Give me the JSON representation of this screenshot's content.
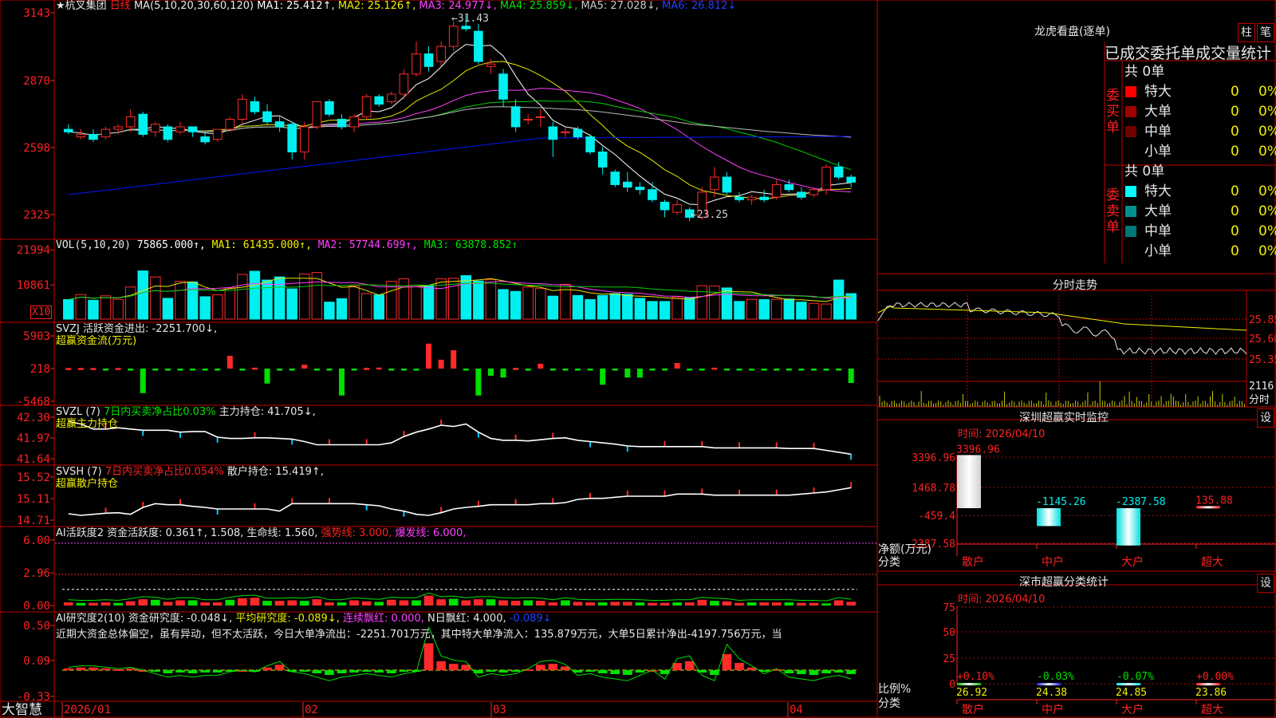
{
  "colors": {
    "up": "#ff2a2a",
    "down": "#00f0f0",
    "grid": "#c00000",
    "ma1": "#ffffff",
    "ma2": "#e8e800",
    "ma3": "#ff40ff",
    "ma4": "#00d000",
    "ma5": "#b8b8b8",
    "ma6": "#0018ff",
    "label_red": "#ff2020",
    "green": "#00e000",
    "yellow": "#f0f000",
    "magenta": "#ff40ff",
    "white": "#e8e8e8"
  },
  "kline": {
    "header": {
      "icon": "star-icon",
      "stock": "★杭叉集团",
      "period": "日线",
      "ma_label": "MA(5,10,20,30,60,120)",
      "ma1": "MA1: 25.412↑,",
      "ma2": "MA2: 25.126↑,",
      "ma3": "MA3: 24.977↓,",
      "ma4": "MA4: 25.859↓,",
      "ma5": "MA5: 27.028↓,",
      "ma6": "MA6: 26.812↓"
    },
    "y_ticks": [
      "3143",
      "2870",
      "2598",
      "2325"
    ],
    "high_label": "31.43",
    "low_label": "23.25"
  },
  "volume": {
    "header": "VOL(5,10,20)",
    "value": "75865.000↑,",
    "ma1": "MA1: 61435.000↑,",
    "ma2": "MA2: 57744.699↑,",
    "ma3": "MA3: 63878.852↑",
    "y_ticks": [
      "21994",
      "10861"
    ],
    "unit": "X10"
  },
  "svzj": {
    "header": "SVZJ  活跃资金进出: -2251.700↓,",
    "sub": "超赢资金流(万元)",
    "y_ticks": [
      "5903",
      "218",
      "-5468"
    ]
  },
  "svzl": {
    "header_a": "SVZL (7)",
    "header_b": "7日内买卖净占比0.03%",
    "header_c": "主力持仓: 41.705↓,",
    "sub": "超赢主力持仓",
    "y_ticks": [
      "42.30",
      "41.97",
      "41.64"
    ]
  },
  "svsh": {
    "header_a": "SVSH (7)",
    "header_b": "7日内买卖净占比0.054%",
    "header_c": "散户持仓: 15.419↑,",
    "sub": "超赢散户持仓",
    "y_ticks": [
      "15.52",
      "15.11",
      "14.71"
    ]
  },
  "ai_active": {
    "header_a": "AI活跃度2 资金活跃度: 0.361↑, 1.508, 生命线: 1.560,",
    "header_b": "强势线: 3.000,",
    "header_c": "爆发线: 6.000,",
    "y_ticks": [
      "6.00",
      "2.96",
      "0.00"
    ]
  },
  "ai_research": {
    "header_a": "AI研究度2(10) 资金研究度: -0.048↓,",
    "header_b": "平均研究度: -0.089↓,",
    "header_c": "连续飘红: 0.000,",
    "header_d": "N日飘红: 4.000,",
    "header_e": "-0.089↓",
    "comment": "近期大资金总体偏空，虽有异动，但不太活跃，今日大单净流出：-2251.701万元，其中特大单净流入：135.879万元，大单5日累计净出-4197.756万元，当",
    "y_ticks": [
      "0.50",
      "0.09",
      "-0.33"
    ]
  },
  "time_axis": {
    "labels": [
      "2026/01",
      "02",
      "03",
      "04"
    ]
  },
  "brand": "大智慧",
  "dragon": {
    "title": "龙虎看盘(逐单)",
    "btn_a": "柱",
    "btn_b": "笔",
    "tab_a": "已成交",
    "tab_b": "委托单",
    "tab_c": "成交量统计",
    "buy": {
      "label": "委买单",
      "count": "共 0单",
      "rows": [
        {
          "name": "特大",
          "v": "0",
          "p": "0%",
          "color": "#ff0000"
        },
        {
          "name": "大单",
          "v": "0",
          "p": "0%",
          "color": "#a00000"
        },
        {
          "name": "中单",
          "v": "0",
          "p": "0%",
          "color": "#700000"
        },
        {
          "name": "小单",
          "v": "0",
          "p": "0%",
          "color": "#000000"
        }
      ]
    },
    "sell": {
      "label": "委卖单",
      "count": "共 0单",
      "rows": [
        {
          "name": "特大",
          "v": "0",
          "p": "0%",
          "color": "#00ffff"
        },
        {
          "name": "大单",
          "v": "0",
          "p": "0%",
          "color": "#009090"
        },
        {
          "name": "中单",
          "v": "0",
          "p": "0%",
          "color": "#007878"
        },
        {
          "name": "小单",
          "v": "0",
          "p": "0%",
          "color": "#000000"
        }
      ]
    }
  },
  "intraday": {
    "title": "分时走势",
    "y_ticks": [
      "25.85",
      "25.60",
      "25.35"
    ],
    "vol_tick": "2116",
    "vol_label": "分时"
  },
  "sz_monitor": {
    "title": "深圳超赢实时监控",
    "btn": "设",
    "date": "时间: 2026/04/10",
    "y_ticks": [
      "3396.96",
      "1468.78",
      "-459.4",
      "-2387.58"
    ],
    "ylabel_a": "净额(万元)",
    "ylabel_b": "分类",
    "categories": [
      "散户",
      "中户",
      "大户",
      "超大"
    ],
    "values": [
      3396.96,
      -1145.26,
      -2387.58,
      135.88
    ],
    "value_labels": [
      "3396.96",
      "-1145.26",
      "-2387.58",
      "135.88"
    ]
  },
  "sz_class": {
    "title": "深市超赢分类统计",
    "btn": "设",
    "date": "时间: 2026/04/10",
    "y_ticks": [
      "75",
      "50",
      "25",
      "0"
    ],
    "ylabel_a": "比例%",
    "ylabel_b": "分类",
    "categories": [
      "散户",
      "中户",
      "大户",
      "超大"
    ],
    "values": [
      26.92,
      24.38,
      24.85,
      23.86
    ],
    "changes": [
      "+0.10%",
      "-0.03%",
      "-0.07%",
      "+0.00%"
    ],
    "value_labels": [
      "26.92",
      "24.38",
      "24.85",
      "23.86"
    ]
  },
  "chart_data": [
    {
      "type": "candlestick",
      "title": "★杭叉集团 日线",
      "x_labels": [
        "2026/01",
        "02",
        "03",
        "04"
      ],
      "ylim": [
        23.25,
        31.43
      ],
      "ohlc": [
        [
          26.9,
          27.1,
          26.7,
          26.8
        ],
        [
          26.6,
          26.9,
          26.5,
          26.7
        ],
        [
          26.7,
          26.9,
          26.4,
          26.5
        ],
        [
          26.6,
          27.0,
          26.5,
          26.9
        ],
        [
          26.9,
          27.1,
          26.7,
          27.0
        ],
        [
          27.0,
          27.7,
          26.8,
          27.4
        ],
        [
          27.5,
          27.6,
          26.6,
          26.7
        ],
        [
          26.8,
          27.2,
          26.6,
          27.1
        ],
        [
          27.0,
          27.1,
          26.4,
          26.5
        ],
        [
          26.8,
          27.2,
          26.7,
          27.0
        ],
        [
          27.0,
          27.0,
          26.6,
          26.8
        ],
        [
          26.6,
          26.8,
          26.3,
          26.4
        ],
        [
          26.5,
          26.9,
          26.4,
          26.9
        ],
        [
          26.9,
          27.4,
          26.8,
          27.3
        ],
        [
          27.3,
          28.3,
          27.1,
          28.1
        ],
        [
          28.0,
          28.2,
          27.5,
          27.6
        ],
        [
          27.6,
          27.9,
          27.1,
          27.2
        ],
        [
          27.2,
          27.4,
          26.8,
          27.0
        ],
        [
          27.1,
          27.2,
          25.7,
          26.0
        ],
        [
          26.0,
          27.2,
          25.7,
          27.0
        ],
        [
          27.0,
          28.0,
          26.9,
          28.0
        ],
        [
          28.0,
          28.1,
          27.4,
          27.5
        ],
        [
          27.3,
          27.5,
          26.9,
          27.0
        ],
        [
          27.0,
          27.5,
          26.8,
          27.4
        ],
        [
          27.4,
          28.3,
          27.3,
          28.2
        ],
        [
          28.2,
          28.3,
          27.8,
          27.9
        ],
        [
          28.0,
          28.4,
          27.9,
          28.3
        ],
        [
          28.3,
          29.3,
          28.1,
          29.1
        ],
        [
          29.1,
          30.4,
          29.0,
          29.9
        ],
        [
          29.9,
          30.2,
          29.2,
          29.4
        ],
        [
          29.6,
          30.4,
          29.4,
          30.2
        ],
        [
          30.2,
          31.2,
          30.0,
          31.0
        ],
        [
          31.0,
          31.43,
          30.8,
          30.9
        ],
        [
          30.8,
          31.1,
          29.5,
          29.6
        ],
        [
          29.4,
          29.7,
          29.1,
          29.5
        ],
        [
          29.1,
          29.3,
          27.8,
          28.1
        ],
        [
          27.8,
          28.1,
          26.8,
          27.0
        ],
        [
          27.3,
          27.5,
          27.1,
          27.3
        ],
        [
          27.4,
          27.7,
          27.0,
          27.4
        ],
        [
          27.0,
          27.2,
          25.8,
          26.5
        ],
        [
          26.8,
          27.0,
          26.6,
          26.8
        ],
        [
          26.9,
          27.0,
          26.5,
          26.6
        ],
        [
          26.6,
          26.7,
          25.9,
          26.0
        ],
        [
          26.0,
          26.2,
          25.1,
          25.4
        ],
        [
          25.2,
          25.3,
          24.6,
          24.7
        ],
        [
          24.8,
          25.2,
          24.4,
          24.6
        ],
        [
          24.6,
          24.8,
          24.3,
          24.5
        ],
        [
          24.5,
          24.8,
          24.0,
          24.1
        ],
        [
          24.0,
          24.1,
          23.4,
          23.7
        ],
        [
          23.6,
          24.1,
          23.5,
          23.9
        ],
        [
          23.7,
          23.8,
          23.25,
          23.4
        ],
        [
          23.4,
          24.6,
          23.3,
          24.4
        ],
        [
          24.5,
          25.4,
          24.2,
          25.0
        ],
        [
          25.0,
          25.2,
          24.3,
          24.4
        ],
        [
          24.2,
          24.4,
          24.0,
          24.1
        ],
        [
          24.1,
          24.3,
          23.9,
          24.2
        ],
        [
          24.2,
          24.5,
          24.0,
          24.1
        ],
        [
          24.2,
          24.9,
          24.1,
          24.7
        ],
        [
          24.7,
          24.9,
          24.4,
          24.5
        ],
        [
          24.4,
          24.6,
          24.1,
          24.2
        ],
        [
          24.3,
          24.6,
          24.2,
          24.5
        ],
        [
          24.5,
          25.5,
          24.3,
          25.4
        ],
        [
          25.4,
          25.6,
          24.9,
          25.0
        ],
        [
          25.0,
          25.1,
          24.6,
          24.8
        ]
      ]
    },
    {
      "type": "bar",
      "title": "VOL(5,10,20)",
      "series": [
        {
          "name": "VOL",
          "values": [
            6200,
            7800,
            6000,
            7400,
            6300,
            10200,
            15300,
            13400,
            6600,
            12000,
            11800,
            7100,
            7700,
            9900,
            14200,
            15200,
            12400,
            13400,
            9600,
            14300,
            14800,
            5400,
            6500,
            10500,
            8100,
            7700,
            12000,
            12800,
            10700,
            10500,
            12800,
            13000,
            13800,
            12100,
            12500,
            9400,
            8800,
            10200,
            9700,
            7300,
            11000,
            7500,
            6200,
            7500,
            8100,
            7900,
            6600,
            5600,
            5600,
            7000,
            6900,
            10600,
            10500,
            9900,
            5600,
            6300,
            6200,
            6300,
            6400,
            5400,
            5000,
            4800,
            12400,
            8100
          ]
        }
      ]
    },
    {
      "type": "bar",
      "title": "超赢资金流(万元)",
      "ylim": [
        -5468,
        5903
      ],
      "series": [
        {
          "name": "SVZJ",
          "values": [
            100,
            100,
            100,
            -100,
            100,
            -120,
            -4100,
            -180,
            -140,
            -200,
            -110,
            -130,
            -230,
            2300,
            -140,
            160,
            -2500,
            -250,
            -180,
            700,
            -140,
            -170,
            -4500,
            -170,
            120,
            180,
            -200,
            -160,
            -180,
            4500,
            1600,
            3300,
            -140,
            -4500,
            -1200,
            -1500,
            120,
            -110,
            880,
            -190,
            -160,
            -190,
            -180,
            -2700,
            -190,
            -1500,
            -1500,
            -190,
            -130,
            1000,
            -170,
            -130,
            160,
            -200,
            -170,
            -170,
            -190,
            -150,
            -180,
            -130,
            -200,
            -200,
            -170,
            -2400
          ]
        }
      ]
    },
    {
      "type": "line",
      "title": "超赢主力持仓",
      "ylim": [
        41.64,
        42.3
      ],
      "series": [
        {
          "name": "SVZL",
          "values": [
            42.22,
            42.18,
            42.1,
            42.1,
            42.12,
            42.1,
            42.08,
            42.08,
            42.08,
            42.05,
            42.06,
            42.06,
            41.97,
            41.95,
            41.95,
            41.96,
            41.96,
            41.95,
            41.94,
            41.9,
            41.85,
            41.85,
            41.85,
            41.85,
            41.85,
            41.85,
            41.88,
            41.98,
            42.05,
            42.1,
            42.16,
            42.14,
            42.18,
            42.05,
            41.95,
            41.92,
            41.92,
            41.91,
            41.93,
            41.95,
            41.96,
            41.92,
            41.9,
            41.88,
            41.86,
            41.83,
            41.82,
            41.82,
            41.82,
            41.82,
            41.82,
            41.82,
            41.8,
            41.8,
            41.8,
            41.8,
            41.8,
            41.8,
            41.79,
            41.79,
            41.79,
            41.76,
            41.73,
            41.7
          ]
        }
      ]
    },
    {
      "type": "line",
      "title": "超赢散户持仓",
      "ylim": [
        14.71,
        15.52
      ],
      "series": [
        {
          "name": "SVSH",
          "values": [
            14.83,
            14.8,
            14.82,
            14.84,
            14.85,
            14.82,
            14.95,
            15.02,
            15.0,
            15.0,
            14.97,
            14.95,
            14.92,
            14.92,
            14.92,
            14.92,
            14.92,
            14.88,
            15.02,
            15.02,
            15.02,
            15.02,
            15.02,
            15.02,
            15.0,
            14.98,
            14.92,
            14.88,
            14.82,
            14.8,
            14.85,
            14.92,
            14.95,
            14.97,
            15.0,
            15.0,
            15.0,
            15.0,
            15.02,
            15.02,
            15.04,
            15.1,
            15.12,
            15.12,
            15.14,
            15.16,
            15.16,
            15.16,
            15.16,
            15.2,
            15.2,
            15.2,
            15.18,
            15.18,
            15.18,
            15.18,
            15.18,
            15.18,
            15.18,
            15.2,
            15.22,
            15.24,
            15.28,
            15.32
          ]
        }
      ]
    },
    {
      "type": "bar",
      "title": "AI活跃度2",
      "ylim": [
        0,
        6
      ],
      "series": [
        {
          "name": "资金活跃度",
          "values": [
            0.3,
            0.25,
            0.25,
            0.3,
            0.25,
            0.4,
            0.6,
            0.55,
            0.35,
            0.5,
            0.5,
            0.3,
            0.3,
            0.55,
            0.7,
            0.75,
            0.45,
            0.45,
            0.5,
            0.45,
            0.6,
            0.3,
            0.3,
            0.5,
            0.4,
            0.35,
            0.55,
            0.5,
            0.5,
            0.95,
            0.6,
            0.65,
            0.5,
            0.6,
            0.6,
            0.5,
            0.45,
            0.5,
            0.45,
            0.3,
            0.5,
            0.35,
            0.3,
            0.3,
            0.35,
            0.35,
            0.3,
            0.25,
            0.25,
            0.3,
            0.3,
            0.55,
            0.45,
            0.4,
            0.25,
            0.3,
            0.3,
            0.3,
            0.3,
            0.25,
            0.25,
            0.2,
            0.5,
            0.36
          ]
        },
        {
          "name": "生命线",
          "values": [
            1.56
          ]
        }
      ]
    },
    {
      "type": "bar",
      "title": "AI研究度2(10)",
      "ylim": [
        -0.33,
        0.5
      ],
      "series": [
        {
          "name": "资金研究度",
          "values": [
            0.02,
            0.03,
            0.03,
            0.02,
            0.01,
            0.02,
            0.0,
            -0.02,
            -0.04,
            -0.03,
            -0.04,
            -0.03,
            -0.03,
            -0.01,
            0.0,
            -0.01,
            0.03,
            0.06,
            -0.01,
            -0.02,
            -0.04,
            -0.06,
            -0.04,
            -0.03,
            -0.02,
            -0.03,
            -0.04,
            -0.02,
            -0.01,
            0.3,
            0.1,
            0.07,
            0.06,
            -0.04,
            -0.02,
            -0.03,
            -0.02,
            0.01,
            0.06,
            0.07,
            0.04,
            -0.03,
            -0.02,
            -0.04,
            -0.05,
            -0.06,
            -0.03,
            0.0,
            -0.05,
            0.08,
            0.1,
            -0.03,
            -0.06,
            0.18,
            0.08,
            0.03,
            -0.02,
            0.01,
            -0.04,
            -0.05,
            -0.06,
            -0.04,
            -0.03,
            -0.05
          ]
        }
      ]
    }
  ]
}
